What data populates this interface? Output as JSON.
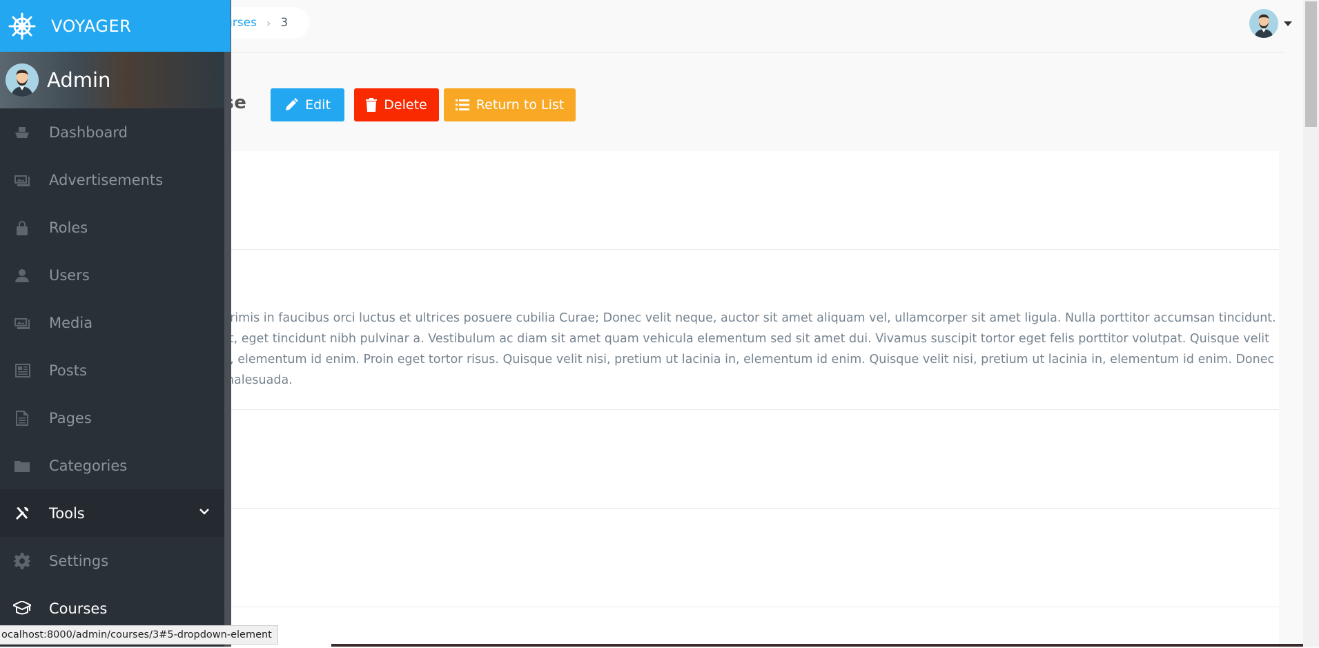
{
  "brand": {
    "name": "VOYAGER"
  },
  "profile": {
    "name": "Admin"
  },
  "breadcrumb": {
    "link": "urses",
    "current": "3"
  },
  "page": {
    "title": "rse"
  },
  "actions": {
    "edit": "Edit",
    "delete": "Delete",
    "return": "Return to List"
  },
  "menu": [
    {
      "label": "Dashboard",
      "icon": "boat-icon"
    },
    {
      "label": "Advertisements",
      "icon": "image-icon"
    },
    {
      "label": "Roles",
      "icon": "lock-icon"
    },
    {
      "label": "Users",
      "icon": "person-icon"
    },
    {
      "label": "Media",
      "icon": "image-icon"
    },
    {
      "label": "Posts",
      "icon": "news-icon"
    },
    {
      "label": "Pages",
      "icon": "file-icon"
    },
    {
      "label": "Categories",
      "icon": "folder-icon"
    },
    {
      "label": "Tools",
      "icon": "tools-icon"
    },
    {
      "label": "Settings",
      "icon": "gear-icon"
    },
    {
      "label": "Courses",
      "icon": "graduation-cap-icon"
    }
  ],
  "description": {
    "line1": "primis in faucibus orci luctus et ultrices posuere cubilia Curae; Donec velit neque, auctor sit amet aliquam vel, ullamcorper sit amet ligula. Nulla porttitor accumsan tincidunt.",
    "line2": "lit, eget tincidunt nibh pulvinar a. Vestibulum ac diam sit amet quam vehicula elementum sed sit amet dui. Vivamus suscipit tortor eget felis porttitor volutpat. Quisque velit",
    "line3": "n, elementum id enim. Proin eget tortor risus. Quisque velit nisi, pretium ut lacinia in, elementum id enim. Quisque velit nisi, pretium ut lacinia in, elementum id enim. Donec",
    "line4": "malesuada."
  },
  "status_bar": {
    "url": "ocalhost:8000/admin/courses/3#5-dropdown-element"
  },
  "colors": {
    "accent": "#22a7f0",
    "danger": "#fa2a00",
    "warning": "#f9a825",
    "sidebar": "#2a3037"
  }
}
